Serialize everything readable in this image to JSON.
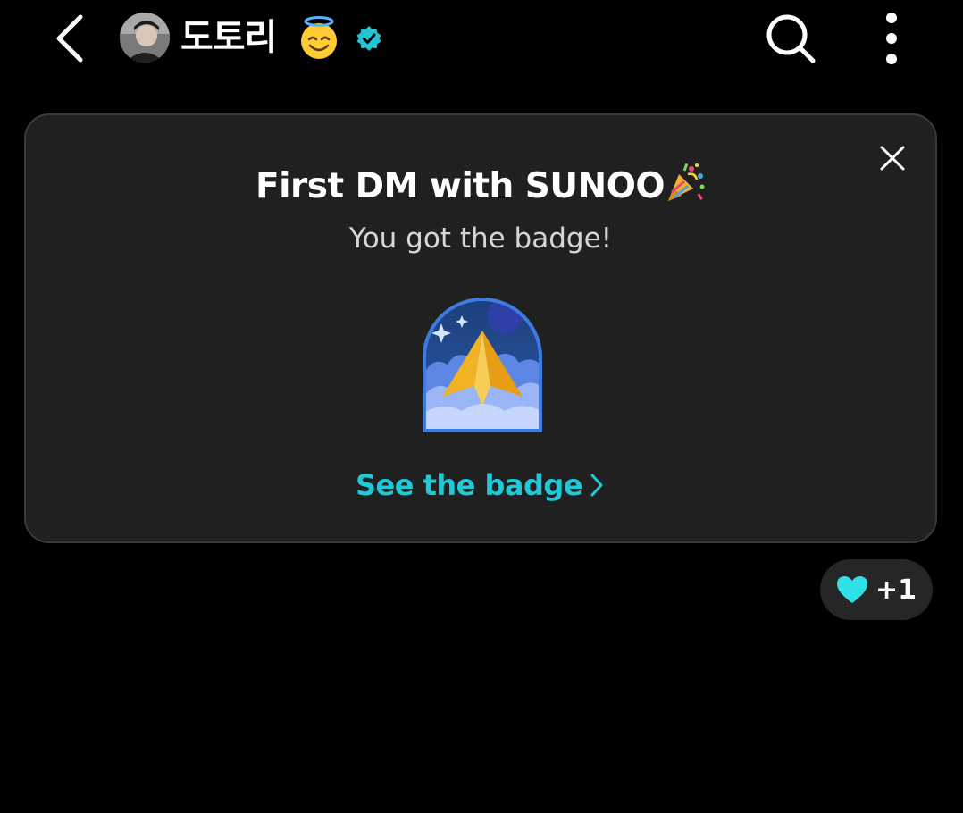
{
  "header": {
    "user_name": "도토리",
    "user_emoji": "halo-smile-emoji",
    "verified_icon": "verified-badge-icon",
    "back_icon": "chevron-left-icon",
    "search_icon": "search-icon",
    "more_icon": "more-vertical-icon"
  },
  "badge_card": {
    "title": "First DM with SUNOO",
    "title_emoji": "party-popper-emoji",
    "subtitle": "You got the badge!",
    "badge_icon": "paper-plane-night-badge",
    "link_label": "See the badge",
    "close_icon": "close-icon"
  },
  "reaction": {
    "icon": "heart-icon",
    "count_label": "+1"
  },
  "colors": {
    "background": "#000000",
    "card": "#202020",
    "accent": "#1fc9d6",
    "verified": "#22c4d4"
  }
}
